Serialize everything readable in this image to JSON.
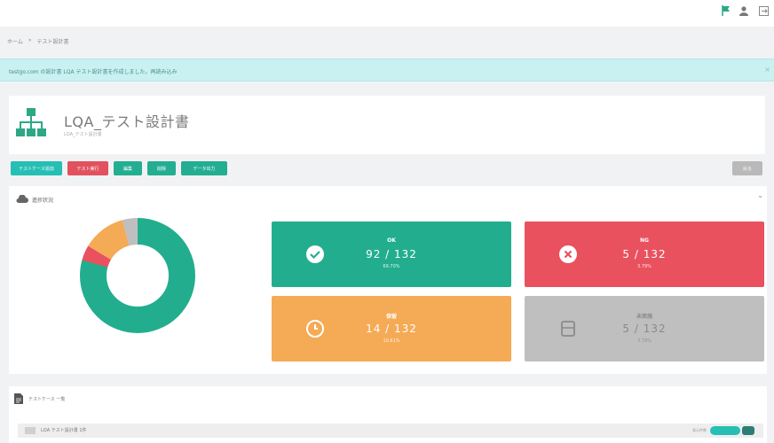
{
  "topbar": {
    "flag_icon": "flag-icon",
    "user_icon": "user-icon",
    "user_label": "",
    "logout_icon": "logout-icon"
  },
  "breadcrumb": {
    "home": "ホーム",
    "sep": "»",
    "current": "テスト設計書"
  },
  "alert": {
    "message": "testgo.com の設計書 LQA テスト設計書を作成しました。再読み込み",
    "close": "×"
  },
  "header": {
    "icon": "org-chart-icon",
    "title": "LQA_テスト設計書",
    "subtitle": "LQA_テスト設計書"
  },
  "actions": {
    "buttons": [
      {
        "label": "テストケース追加"
      },
      {
        "label": "テスト実行"
      },
      {
        "label": "編集"
      },
      {
        "label": "削除"
      },
      {
        "label": "データ出力"
      }
    ],
    "right_button": "戻る"
  },
  "stats": {
    "label": "進捗状況",
    "collapse": "⌄",
    "tiles": [
      {
        "key": "ok",
        "title": "OK",
        "value": "92 / 132",
        "sub": "69.70%"
      },
      {
        "key": "ng",
        "title": "NG",
        "value": "5 / 132",
        "sub": "3.79%"
      },
      {
        "key": "pending",
        "title": "保留",
        "value": "14 / 132",
        "sub": "10.61%"
      },
      {
        "key": "untested",
        "title": "未実施",
        "value": "5 / 132",
        "sub": "3.79%"
      }
    ]
  },
  "chart_data": {
    "type": "pie",
    "donut": true,
    "categories": [
      "OK",
      "NG",
      "保留",
      "未実施"
    ],
    "values": [
      92,
      5,
      14,
      5
    ],
    "colors": [
      "#22ae8e",
      "#e9515f",
      "#f5aa55",
      "#bfbfbf"
    ]
  },
  "list": {
    "label": "テストケース 一覧",
    "row_text": "LQA テスト設計書 1件",
    "row_right": "表示件数",
    "toggle_label": ""
  }
}
